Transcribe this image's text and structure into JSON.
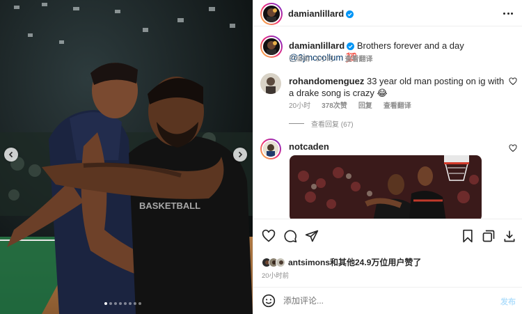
{
  "header": {
    "username": "damianlillard",
    "verified": true
  },
  "caption": {
    "username": "damianlillard",
    "text": "Brothers forever and a day",
    "mention": "@3jmccollum",
    "emoji": "💯",
    "edited_label": "已编辑",
    "time": "5小时",
    "translate_label": "查看翻译"
  },
  "comments": [
    {
      "username": "rohandomenguez",
      "text": "33 year old man posting on ig with a drake song is crazy",
      "emoji": "😂",
      "time": "20小时",
      "likes": "378次赞",
      "reply_label": "回复",
      "translate_label": "查看翻译",
      "view_replies_label": "查看回复 (67)"
    },
    {
      "username": "notcaden"
    }
  ],
  "likes": {
    "text": "antsimons和其他24.9万位用户赞了"
  },
  "post_time": "20小时前",
  "comment_box": {
    "placeholder": "添加评论...",
    "post_label": "发布"
  },
  "carousel": {
    "total": 8,
    "active_index": 0
  },
  "icons": {
    "prev": "chevron-left-icon",
    "next": "chevron-right-icon",
    "like": "heart-icon",
    "comment": "comment-bubble-icon",
    "share": "paper-plane-icon",
    "save": "bookmark-icon",
    "carousel_posts": "multiple-images-icon",
    "download": "download-icon",
    "emoji": "smiley-icon",
    "more": "more-horizontal-icon",
    "verified": "verified-badge-icon"
  },
  "colors": {
    "verified": "#0095f6",
    "mention": "#00376b",
    "secondary_text": "#8e8e8e",
    "post_button_disabled": "#b2dffc"
  }
}
